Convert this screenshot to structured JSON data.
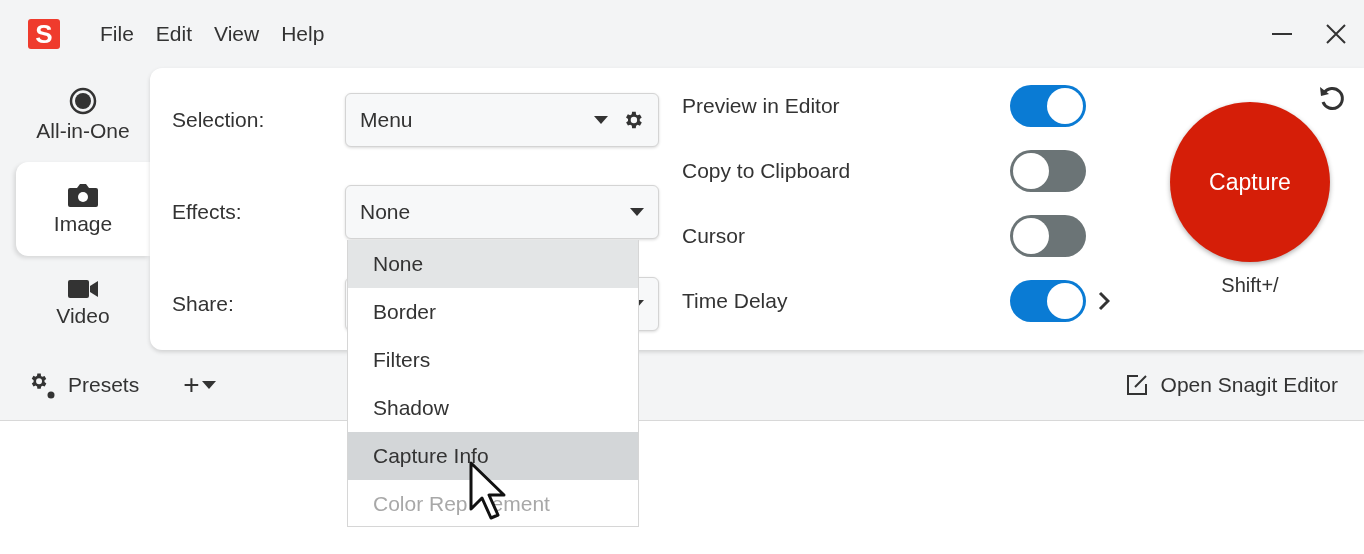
{
  "app": {
    "logo": "S"
  },
  "menu": [
    "File",
    "Edit",
    "View",
    "Help"
  ],
  "modes": [
    {
      "label": "All-in-One",
      "kind": "record",
      "selected": false
    },
    {
      "label": "Image",
      "kind": "camera",
      "selected": true
    },
    {
      "label": "Video",
      "kind": "video",
      "selected": false
    }
  ],
  "settings": [
    {
      "label": "Selection:",
      "value": "Menu",
      "gear": true
    },
    {
      "label": "Effects:",
      "value": "None",
      "gear": false
    },
    {
      "label": "Share:",
      "gear": false
    }
  ],
  "toggles": [
    {
      "label": "Preview in Editor",
      "on": true,
      "more": false
    },
    {
      "label": "Copy to Clipboard",
      "on": false,
      "more": false
    },
    {
      "label": "Cursor",
      "on": false,
      "more": false
    },
    {
      "label": "Time Delay",
      "on": true,
      "more": true
    }
  ],
  "capture": {
    "label": "Capture",
    "shortcut": "Shift+/"
  },
  "bottom": {
    "presets": "Presets",
    "add": "+",
    "editor": "Open Snagit Editor"
  },
  "dropdown": [
    {
      "label": "None",
      "selected": true,
      "hovered": false,
      "disabled": false
    },
    {
      "label": "Border",
      "selected": false,
      "hovered": false,
      "disabled": false
    },
    {
      "label": "Filters",
      "selected": false,
      "hovered": false,
      "disabled": false
    },
    {
      "label": "Shadow",
      "selected": false,
      "hovered": false,
      "disabled": false
    },
    {
      "label": "Capture Info",
      "selected": false,
      "hovered": true,
      "disabled": false
    },
    {
      "label": "Color Rep",
      "label_tail": "ement",
      "selected": false,
      "hovered": false,
      "disabled": true
    }
  ]
}
